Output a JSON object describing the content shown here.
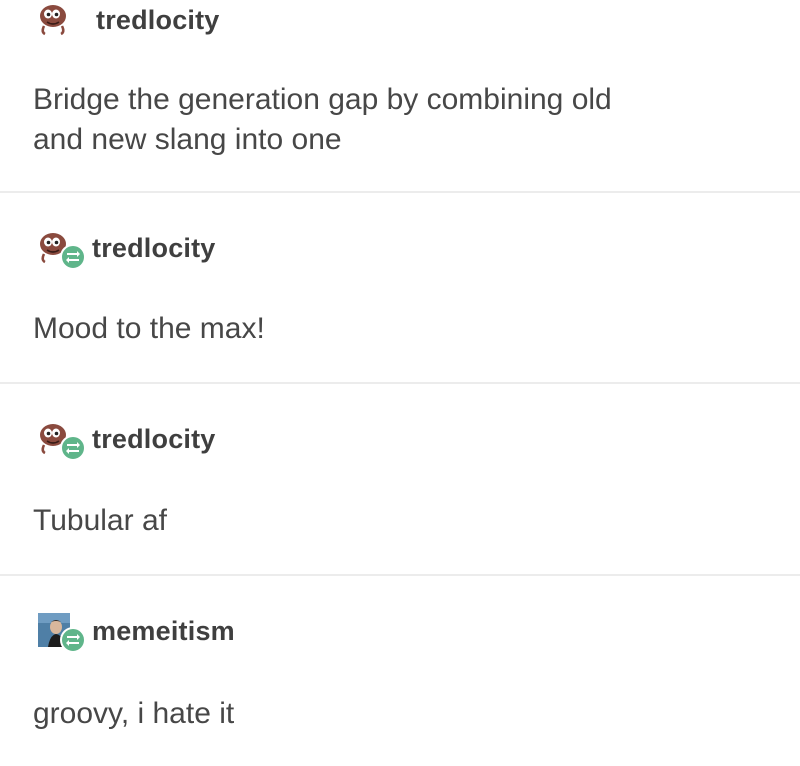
{
  "posts": [
    {
      "username": "tredlocity",
      "avatar_icon": "cartoon-head-icon",
      "reblog": false,
      "text_lines": [
        "Bridge the generation gap by combining old",
        "and new slang into one"
      ]
    },
    {
      "username": "tredlocity",
      "avatar_icon": "cartoon-head-icon",
      "reblog": true,
      "reblog_icon": "reblog-icon",
      "text_lines": [
        "Mood to the max!"
      ]
    },
    {
      "username": "tredlocity",
      "avatar_icon": "cartoon-head-icon",
      "reblog": true,
      "reblog_icon": "reblog-icon",
      "text_lines": [
        "Tubular af"
      ]
    },
    {
      "username": "memeitism",
      "avatar_icon": "photo-avatar-icon",
      "reblog": true,
      "reblog_icon": "reblog-icon",
      "text_lines": [
        "groovy, i hate it"
      ]
    }
  ],
  "colors": {
    "reblog_badge": "#5fb58a",
    "avatar_face": "#8a4a3e",
    "divider": "#ececec",
    "text": "#474747"
  }
}
